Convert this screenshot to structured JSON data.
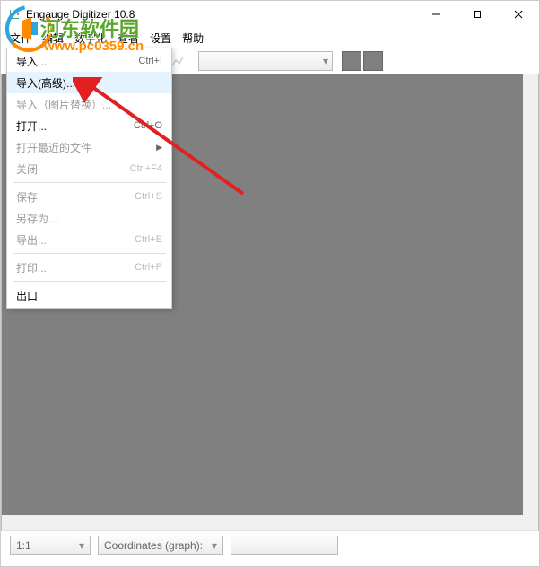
{
  "titlebar": {
    "title": "Engauge Digitizer 10.8"
  },
  "menubar": {
    "items": [
      "文件",
      "编辑",
      "数字化",
      "查看",
      "设置",
      "帮助"
    ]
  },
  "file_menu": {
    "items": [
      {
        "label": "导入...",
        "shortcut": "Ctrl+I",
        "enabled": true
      },
      {
        "label": "导入(高级)...",
        "shortcut": "",
        "enabled": true,
        "highlighted": true
      },
      {
        "label": "导入（图片替换）...",
        "shortcut": "",
        "enabled": false
      },
      {
        "label": "打开...",
        "shortcut": "Ctrl+O",
        "enabled": true
      },
      {
        "label": "打开最近的文件",
        "shortcut": "",
        "enabled": false,
        "submenu": true
      },
      {
        "label": "关闭",
        "shortcut": "Ctrl+F4",
        "enabled": false
      },
      {
        "sep": true
      },
      {
        "label": "保存",
        "shortcut": "Ctrl+S",
        "enabled": false
      },
      {
        "label": "另存为...",
        "shortcut": "",
        "enabled": false
      },
      {
        "label": "导出...",
        "shortcut": "Ctrl+E",
        "enabled": false
      },
      {
        "sep": true
      },
      {
        "label": "打印...",
        "shortcut": "Ctrl+P",
        "enabled": false
      },
      {
        "sep": true
      },
      {
        "label": "出口",
        "shortcut": "",
        "enabled": true
      }
    ]
  },
  "statusbar": {
    "zoom": "1:1",
    "coords_label": "Coordinates (graph):",
    "coords_value": ""
  },
  "watermark": {
    "text": "河东软件园",
    "url": "www.pc0359.cn"
  }
}
